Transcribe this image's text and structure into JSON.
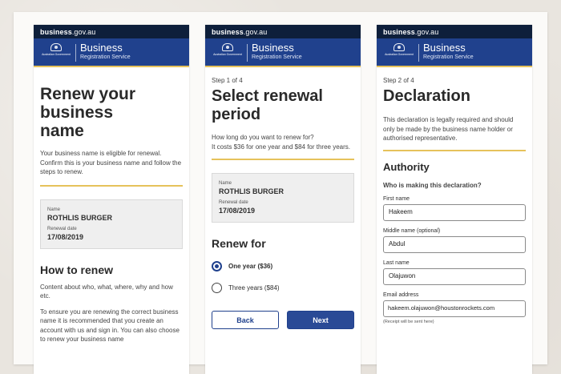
{
  "brand": {
    "domain": "business.gov.au",
    "domain_main": "business",
    "domain_tld": ".gov.au",
    "gov_label": "Australian Government",
    "title": "Business",
    "subtitle": "Registration Service",
    "header_color": "#20418d",
    "topbar_color": "#0e1f3b",
    "accent_rule_color": "#e6c25b"
  },
  "screen1": {
    "heading_lines": [
      "Renew your",
      "business",
      "name"
    ],
    "intro": "Your business name is eligible for renewal. Confirm this is your business name and follow the steps to renew.",
    "card": {
      "name_label": "Name",
      "name_value": "ROTHLIS BURGER",
      "date_label": "Renewal date",
      "date_value": "17/08/2019"
    },
    "how_heading": "How to renew",
    "para1": "Content about who, what, where, why and how etc.",
    "para2": "To ensure you are renewing the correct business name it is recommended that you create an account with us and sign in. You can also choose to renew your business name"
  },
  "screen2": {
    "step": "Step 1 of 4",
    "heading_lines": [
      "Select renewal",
      "period"
    ],
    "question": "How long do you want to renew for?",
    "costs": "It costs $36 for one year and $84 for three years.",
    "card": {
      "name_label": "Name",
      "name_value": "ROTHLIS BURGER",
      "date_label": "Renewal date",
      "date_value": "17/08/2019"
    },
    "renew_heading": "Renew for",
    "options": [
      {
        "label": "One year ($36)",
        "selected": true
      },
      {
        "label": "Three years ($84)",
        "selected": false
      }
    ],
    "back_label": "Back",
    "next_label": "Next"
  },
  "screen3": {
    "step": "Step 2 of 4",
    "heading": "Declaration",
    "intro": "This declaration is legally required and should only be made by the business name holder or authorised representative.",
    "authority_heading": "Authority",
    "question": "Who is making this declaration?",
    "fields": {
      "first_label": "First name",
      "first_value": "Hakeem",
      "middle_label": "Middle name (optional)",
      "middle_value": "Abdul",
      "last_label": "Last name",
      "last_value": "Olajuwon",
      "email_label": "Email address",
      "email_value": "hakeem.olajuwon@houstonrockets.com",
      "email_hint": "(Receipt will be sent here)"
    }
  }
}
